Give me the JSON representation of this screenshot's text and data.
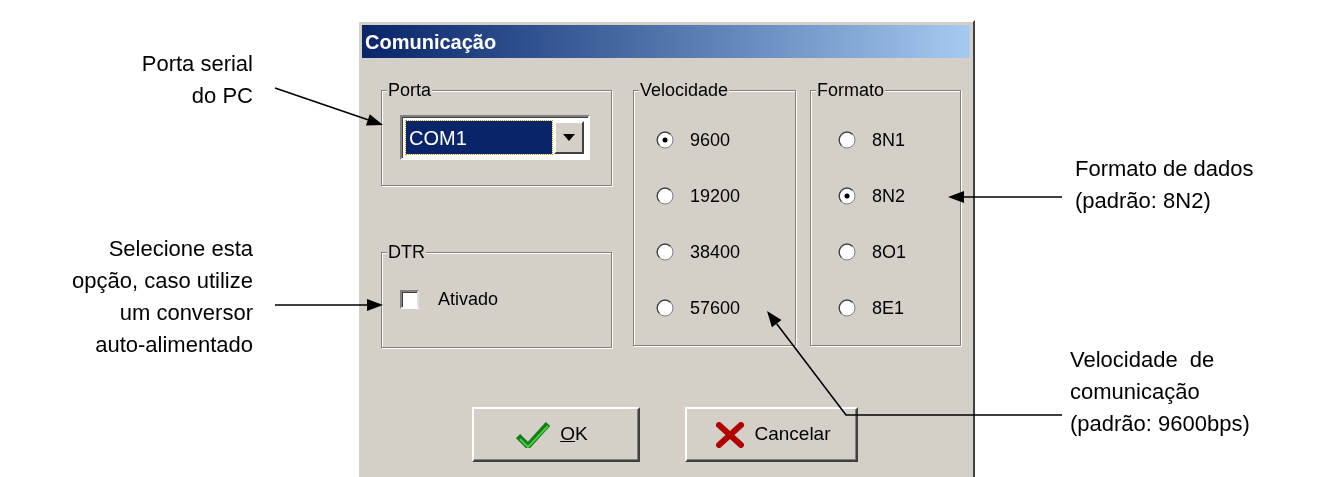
{
  "dialog": {
    "title": "Comunicação",
    "port_group": {
      "label": "Porta",
      "combo": {
        "value": "COM1",
        "highlighted": true
      }
    },
    "dtr_group": {
      "label": "DTR",
      "checkbox": {
        "label": "Ativado",
        "checked": false
      }
    },
    "speed_group": {
      "label": "Velocidade",
      "options": [
        {
          "label": "9600",
          "selected": true
        },
        {
          "label": "19200",
          "selected": false
        },
        {
          "label": "38400",
          "selected": false
        },
        {
          "label": "57600",
          "selected": false
        }
      ]
    },
    "format_group": {
      "label": "Formato",
      "options": [
        {
          "label": "8N1",
          "selected": false
        },
        {
          "label": "8N2",
          "selected": true
        },
        {
          "label": "8O1",
          "selected": false
        },
        {
          "label": "8E1",
          "selected": false
        }
      ]
    },
    "buttons": [
      {
        "label": "OK",
        "kind": "ok",
        "underlined_first_letter": true
      },
      {
        "label": "Cancelar",
        "kind": "cancel"
      }
    ]
  },
  "annotations": [
    {
      "kind": "port",
      "lines": [
        "Porta serial",
        "do PC"
      ]
    },
    {
      "kind": "dtr",
      "lines": [
        "Selecione esta",
        "opção, caso utilize",
        "um conversor",
        "auto-alimentado"
      ]
    },
    {
      "kind": "format",
      "lines": [
        "Formato de dados",
        "(padrão: 8N2)"
      ]
    },
    {
      "kind": "speed",
      "lines": [
        "Velocidade  de",
        "comunicação",
        "(padrão: 9600bps)"
      ]
    }
  ]
}
